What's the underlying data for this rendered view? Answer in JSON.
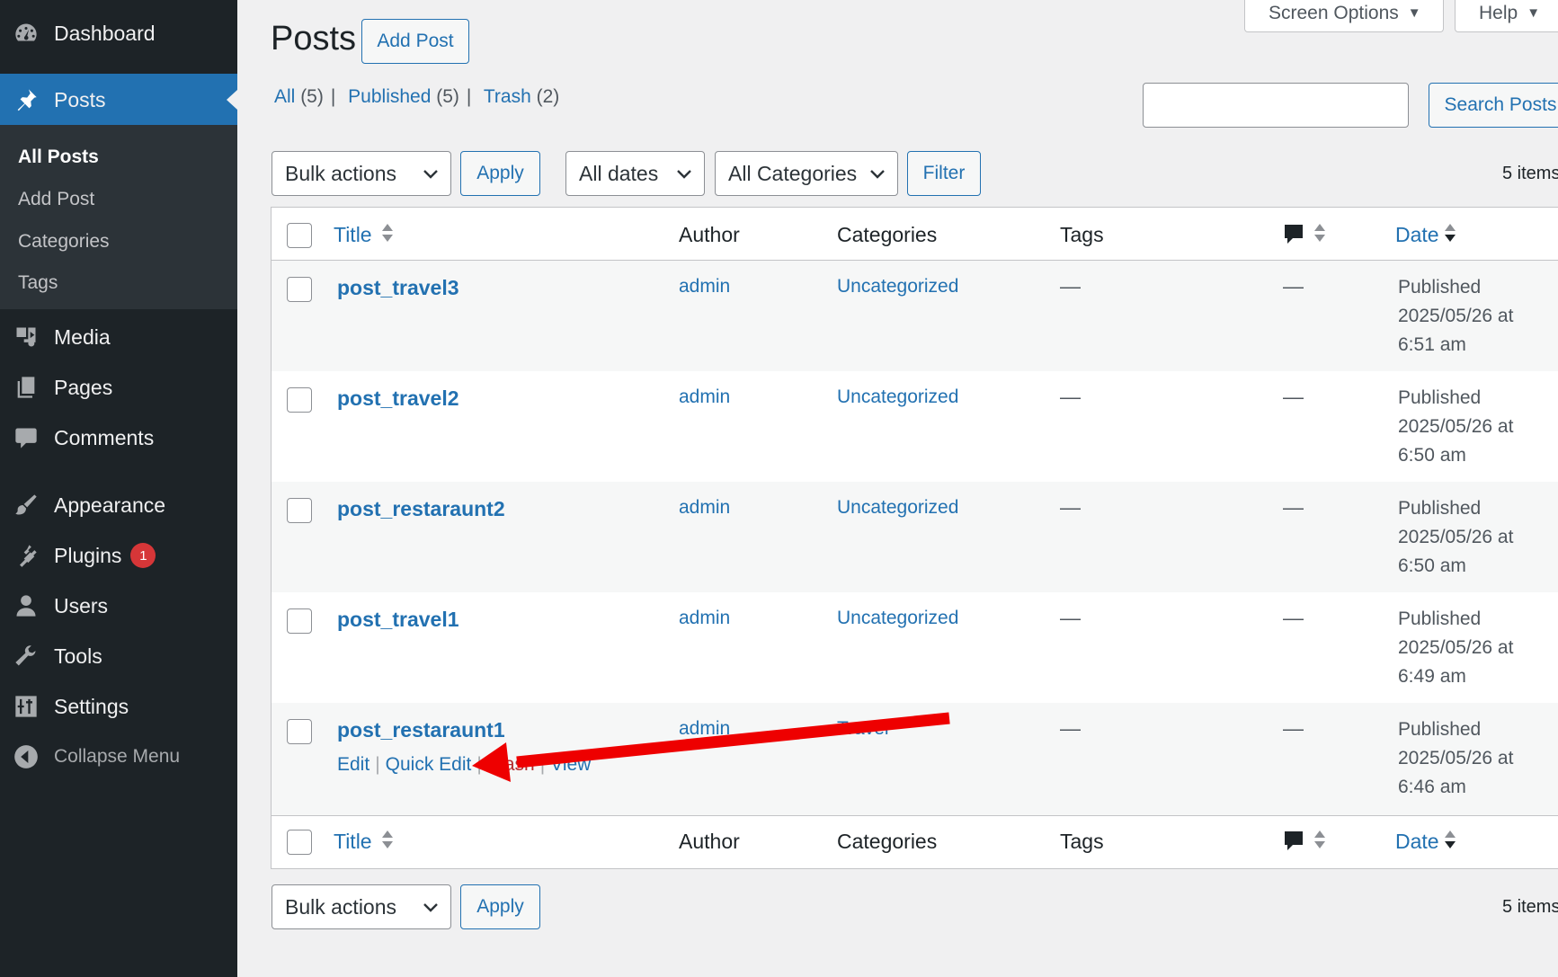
{
  "sidebar": {
    "items": [
      {
        "label": "Dashboard",
        "icon": "dashboard-icon"
      },
      {
        "label": "Posts",
        "icon": "pin-icon"
      },
      {
        "label": "Media",
        "icon": "media-icon"
      },
      {
        "label": "Pages",
        "icon": "pages-icon"
      },
      {
        "label": "Comments",
        "icon": "comment-icon"
      },
      {
        "label": "Appearance",
        "icon": "brush-icon"
      },
      {
        "label": "Plugins",
        "icon": "plugin-icon",
        "badge": "1"
      },
      {
        "label": "Users",
        "icon": "user-icon"
      },
      {
        "label": "Tools",
        "icon": "wrench-icon"
      },
      {
        "label": "Settings",
        "icon": "settings-icon"
      }
    ],
    "submenu": [
      "All Posts",
      "Add Post",
      "Categories",
      "Tags"
    ],
    "collapse": "Collapse Menu"
  },
  "header": {
    "screen_options": "Screen Options",
    "help": "Help",
    "title": "Posts",
    "add_post": "Add Post"
  },
  "views": {
    "all": "All",
    "all_count": "(5)",
    "published": "Published",
    "published_count": "(5)",
    "trash": "Trash",
    "trash_count": "(2)"
  },
  "search": {
    "value": "",
    "button": "Search Posts"
  },
  "filters": {
    "bulk_actions": "Bulk actions",
    "apply": "Apply",
    "dates": "All dates",
    "categories": "All Categories",
    "filter": "Filter",
    "items_count": "5 items"
  },
  "table": {
    "columns": {
      "title": "Title",
      "author": "Author",
      "categories": "Categories",
      "tags": "Tags",
      "comments_icon": "comment-bubble-icon",
      "date": "Date"
    },
    "rows": [
      {
        "title": "post_travel3",
        "author": "admin",
        "category": "Uncategorized",
        "tags": "—",
        "comments": "—",
        "status": "Published",
        "date": "2025/05/26 at",
        "time": "6:51 am"
      },
      {
        "title": "post_travel2",
        "author": "admin",
        "category": "Uncategorized",
        "tags": "—",
        "comments": "—",
        "status": "Published",
        "date": "2025/05/26 at",
        "time": "6:50 am"
      },
      {
        "title": "post_restaraunt2",
        "author": "admin",
        "category": "Uncategorized",
        "tags": "—",
        "comments": "—",
        "status": "Published",
        "date": "2025/05/26 at",
        "time": "6:50 am"
      },
      {
        "title": "post_travel1",
        "author": "admin",
        "category": "Uncategorized",
        "tags": "—",
        "comments": "—",
        "status": "Published",
        "date": "2025/05/26 at",
        "time": "6:49 am"
      },
      {
        "title": "post_restaraunt1",
        "author": "admin",
        "category": "Travel",
        "tags": "—",
        "comments": "—",
        "status": "Published",
        "date": "2025/05/26 at",
        "time": "6:46 am"
      }
    ],
    "row_actions": {
      "edit": "Edit",
      "quick_edit": "Quick Edit",
      "trash": "Trash",
      "view": "View"
    }
  },
  "annotation": {
    "arrow_color": "#ee0000"
  }
}
